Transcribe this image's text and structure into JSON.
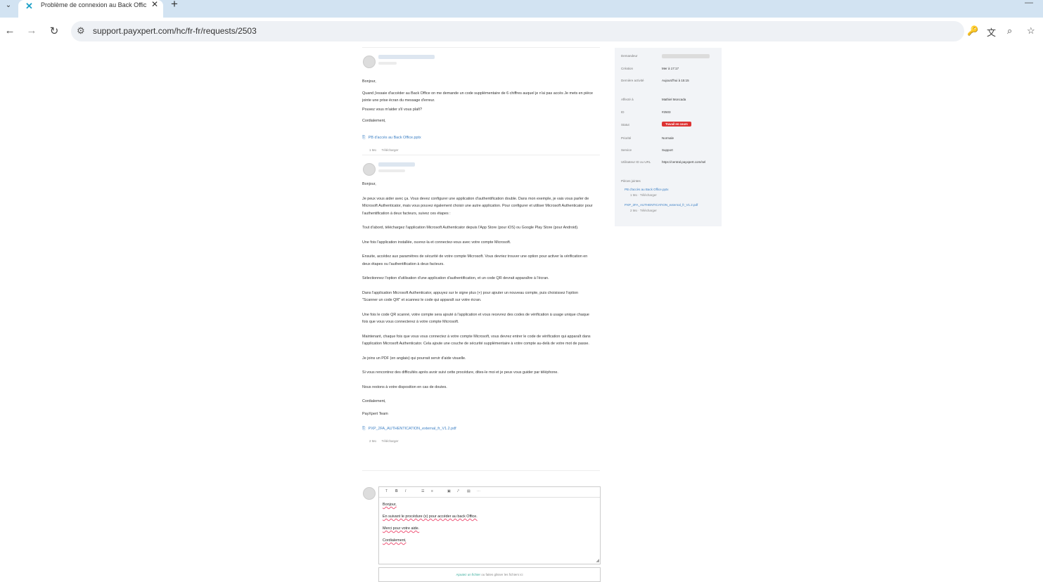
{
  "browser": {
    "tab_title": "Problème de connexion au Back Office",
    "url": "support.payxpert.com/hc/fr-fr/requests/2503"
  },
  "messages": [
    {
      "author": "",
      "paragraphs": [
        "Bonjour,",
        "Quand j'essaie d'accéder au Back Office on me demande un code supplémentaire de 6 chiffres auquel je n'ai pas accès Je mets en pièce jointe une prise écran du message d'erreur.",
        "Pouvez vous m'aider s'il vous plaît?",
        "Cordialement,"
      ],
      "attachment": {
        "name": "PB d'accès au Back Office.pptx",
        "size": "1 Mo",
        "action": "Télécharger"
      }
    },
    {
      "author": "",
      "paragraphs": [
        "Bonjour,",
        "Je peux vous aider avec ça. Vous devez configurer une application d'authentification double. Dans mon exemple, je vais vous parler de Microsoft Authenticator, mais vous pouvez également choisir une autre application. Pour configurer et utiliser Microsoft Authenticator pour l'authentification à deux facteurs, suivez ces étapes :",
        "Tout d'abord, téléchargez l'application Microsoft Authenticator depuis l'App Store (pour iOS) ou Google Play Store (pour Android).",
        "Une fois l'application installée, ouvrez-la et connectez-vous avec votre compte Microsoft.",
        "Ensuite, accédez aux paramètres de sécurité de votre compte Microsoft. Vous devriez trouver une option pour activer la vérification en deux étapes ou l'authentification à deux facteurs.",
        "Sélectionnez l'option d'utilisation d'une application d'authentification, et un code QR devrait apparaître à l'écran.",
        "Dans l'application Microsoft Authenticator, appuyez sur le signe plus (+) pour ajouter un nouveau compte, puis choisissez l'option \"Scanner un code QR\" et scannez le code qui apparaît sur votre écran.",
        "Une fois le code QR scanné, votre compte sera ajouté à l'application et vous recevrez des codes de vérification à usage unique chaque fois que vous vous connecterez à votre compte Microsoft.",
        "Maintenant, chaque fois que vous vous connectez à votre compte Microsoft, vous devrez entrer le code de vérification qui apparaît dans l'application Microsoft Authenticator. Cela ajoute une couche de sécurité supplémentaire à votre compte au-delà de votre mot de passe.",
        "Je joins un PDF (en anglais) qui pourrait servir d'aide visuelle.",
        "Si vous rencontrez des difficultés après avoir suivi cette procédure, dites-le moi et je peux vous guider par téléphone.",
        "Nous restons à votre disposition en cas de doutes.",
        "Cordialement,",
        "PayXpert Team"
      ],
      "attachment": {
        "name": "PXP_2FA_AUTHENTICATION_external_fr_V1.2.pdf",
        "size": "2 Mo",
        "action": "Télécharger"
      }
    }
  ],
  "sidebar": {
    "fields": [
      {
        "label": "Demandeur",
        "value": ""
      },
      {
        "label": "Création",
        "value": "Mer à 17:17"
      },
      {
        "label": "Dernière activité",
        "value": "Aujourd'hui à 15:15"
      },
      {
        "label": "Affecté à",
        "value": "Mathiel Moncada"
      },
      {
        "label": "ID",
        "value": "#2503"
      },
      {
        "label": "Statut",
        "value": "Travail en cours"
      },
      {
        "label": "Priorité",
        "value": "Normale"
      },
      {
        "label": "Service",
        "value": "Support"
      },
      {
        "label": "Utilisateur ID ou URL",
        "value": "https://central.payxpert.com/sel"
      }
    ],
    "attachments_label": "Pièces jointes",
    "attachments": [
      {
        "name": "PB d'accès au Back Office.pptx",
        "meta": "1 Mo · Télécharger"
      },
      {
        "name": "PXP_2FA_AUTHENTICATION_external_fr_V1.2.pdf",
        "meta": "2 Mo · Télécharger"
      }
    ]
  },
  "editor": {
    "lines": [
      "Bonjour,",
      "En suivant le procédure (x) pour accéder au back Office.",
      "Merci pour votre aide.",
      "Cordialement,"
    ],
    "dropzone_link": "Ajoutez un fichier",
    "dropzone_text": "ou faites glisser les fichiers ici"
  },
  "colors": {
    "status_red": "#dd3333",
    "link_blue": "#3b7fc4",
    "tabbar": "#d2e3f2"
  }
}
